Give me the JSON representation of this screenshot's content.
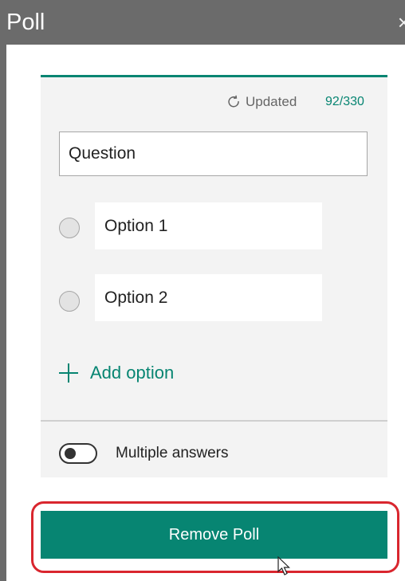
{
  "panel": {
    "title": "Poll",
    "close_icon": "×"
  },
  "status": {
    "icon": "refresh-icon",
    "text": "Updated",
    "count": "92/330"
  },
  "question": {
    "value": "Question"
  },
  "options": [
    {
      "value": "Option 1"
    },
    {
      "value": "Option 2"
    }
  ],
  "add_option": {
    "icon": "plus-icon",
    "label": "Add option"
  },
  "multiple_answers": {
    "label": "Multiple answers",
    "enabled": false
  },
  "remove_button": {
    "label": "Remove Poll"
  },
  "colors": {
    "accent": "#078572",
    "highlight": "#d9262e",
    "titlebar": "#6b6b6b",
    "card": "#f3f3f3"
  }
}
